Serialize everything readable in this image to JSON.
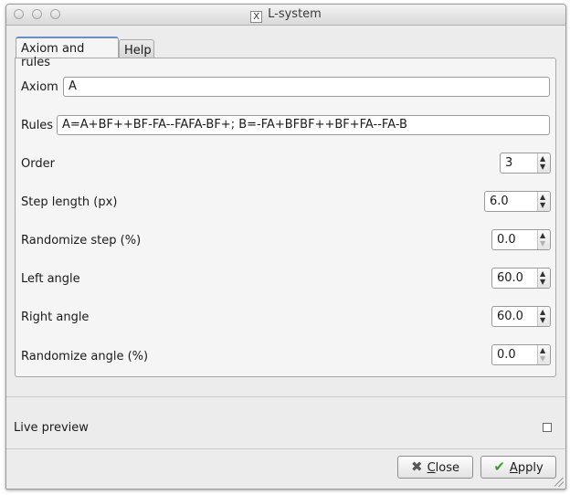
{
  "window": {
    "title": "L-system"
  },
  "tabs": [
    {
      "label": "Axiom and rules",
      "active": true
    },
    {
      "label": "Help",
      "active": false
    }
  ],
  "form": {
    "axiom": {
      "label": "Axiom",
      "value": "A"
    },
    "rules": {
      "label": "Rules",
      "value": "A=A+BF++BF-FA--FAFA-BF+; B=-FA+BFBF++BF+FA--FA-B"
    },
    "order": {
      "label": "Order",
      "value": "3"
    },
    "step_length": {
      "label": "Step length (px)",
      "value": "6.0"
    },
    "randomize_step": {
      "label": "Randomize step (%)",
      "value": "0.0"
    },
    "left_angle": {
      "label": "Left angle",
      "value": "60.0"
    },
    "right_angle": {
      "label": "Right angle",
      "value": "60.0"
    },
    "randomize_angle": {
      "label": "Randomize angle (%)",
      "value": "0.0"
    }
  },
  "live_preview": {
    "label": "Live preview",
    "checked": false
  },
  "buttons": {
    "close": {
      "label_first": "C",
      "label_rest": "lose"
    },
    "apply": {
      "label_first": "A",
      "label_rest": "pply"
    }
  },
  "icons": {
    "close": "x-icon",
    "apply": "checkmark-icon",
    "title": "x11-icon"
  }
}
